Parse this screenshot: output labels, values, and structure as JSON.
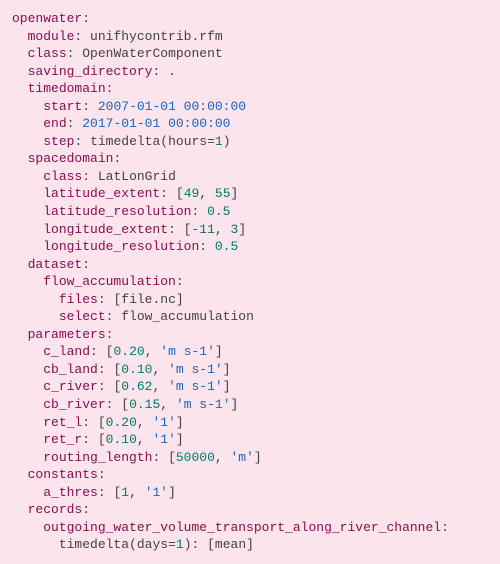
{
  "root_key": "openwater",
  "module_key": "module",
  "module_val": "unifhycontrib.rfm",
  "class_key": "class",
  "class_val": "OpenWaterComponent",
  "savdir_key": "saving_directory",
  "savdir_val": ".",
  "td_key": "timedomain",
  "td_start_key": "start",
  "td_start_val": "2007-01-01 00:00:00",
  "td_end_key": "end",
  "td_end_val": "2017-01-01 00:00:00",
  "td_step_key": "step",
  "td_step_fn": "timedelta",
  "td_step_arg_key": "hours",
  "td_step_arg_val": "1",
  "sd_key": "spacedomain",
  "sd_class_key": "class",
  "sd_class_val": "LatLonGrid",
  "lat_ext_key": "latitude_extent",
  "lat_ext_lo": "49",
  "lat_ext_hi": "55",
  "lat_res_key": "latitude_resolution",
  "lat_res_val": "0.5",
  "lon_ext_key": "longitude_extent",
  "lon_ext_lo": "-11",
  "lon_ext_hi": "3",
  "lon_res_key": "longitude_resolution",
  "lon_res_val": "0.5",
  "ds_key": "dataset",
  "fa_key": "flow_accumulation",
  "fa_files_key": "files",
  "fa_files_val": "file.nc",
  "fa_select_key": "select",
  "fa_select_val": "flow_accumulation",
  "par_key": "parameters",
  "cland_key": "c_land",
  "cland_v": "0.20",
  "cland_u": "'m s-1'",
  "cbland_key": "cb_land",
  "cbland_v": "0.10",
  "cbland_u": "'m s-1'",
  "criver_key": "c_river",
  "criver_v": "0.62",
  "criver_u": "'m s-1'",
  "cbriver_key": "cb_river",
  "cbriver_v": "0.15",
  "cbriver_u": "'m s-1'",
  "retl_key": "ret_l",
  "retl_v": "0.20",
  "retl_u": "'1'",
  "retr_key": "ret_r",
  "retr_v": "0.10",
  "retr_u": "'1'",
  "rlen_key": "routing_length",
  "rlen_v": "50000",
  "rlen_u": "'m'",
  "const_key": "constants",
  "athres_key": "a_thres",
  "athres_v": "1",
  "athres_u": "'1'",
  "rec_key": "records",
  "owvt_key": "outgoing_water_volume_transport_along_river_channel",
  "rec_step_fn": "timedelta",
  "rec_step_arg_key": "days",
  "rec_step_arg_val": "1",
  "rec_step_val": "mean"
}
